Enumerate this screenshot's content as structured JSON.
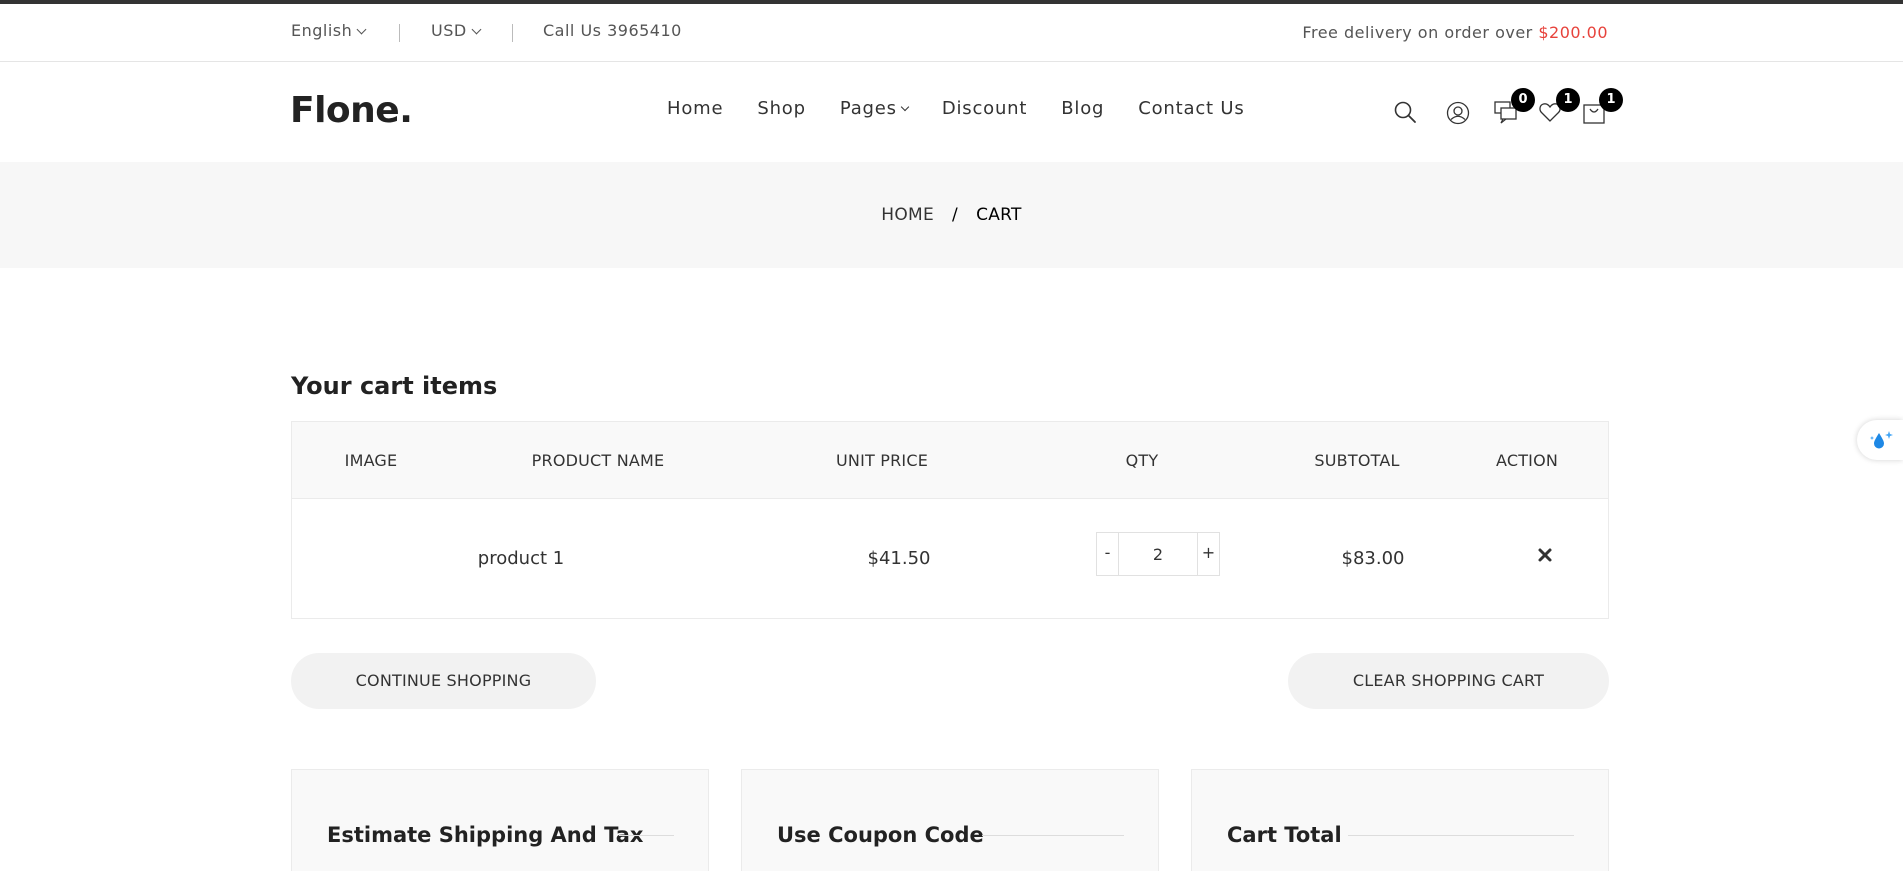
{
  "topbar": {
    "language": "English",
    "currency": "USD",
    "call_us": "Call Us 3965410",
    "free_delivery_text": "Free delivery on order over ",
    "free_delivery_amount": "$200.00",
    "accent_color": "#e7423b"
  },
  "header": {
    "logo": "Flone.",
    "nav": [
      {
        "label": "Home"
      },
      {
        "label": "Shop"
      },
      {
        "label": "Pages"
      },
      {
        "label": "Discount"
      },
      {
        "label": "Blog"
      },
      {
        "label": "Contact Us"
      }
    ],
    "icons": {
      "search": "search-icon",
      "account": "user-icon",
      "compare": "compare-icon",
      "wishlist": "heart-icon",
      "cart": "shopping-bag-icon"
    },
    "badges": {
      "compare_count": "0",
      "wishlist_count": "1",
      "cart_count": "1"
    }
  },
  "breadcrumb": {
    "home": "HOME",
    "separator": "/",
    "current": "CART"
  },
  "cart": {
    "title": "Your cart items",
    "columns": [
      "IMAGE",
      "PRODUCT NAME",
      "UNIT PRICE",
      "QTY",
      "SUBTOTAL",
      "ACTION"
    ],
    "rows": [
      {
        "product_name": "product 1",
        "unit_price": "$41.50",
        "qty": "2",
        "subtotal": "$83.00",
        "action_icon": "close-icon"
      }
    ],
    "qty_dec": "-",
    "qty_inc": "+",
    "continue_label": "CONTINUE SHOPPING",
    "clear_label": "CLEAR SHOPPING CART"
  },
  "panels": {
    "shipping_title": "Estimate Shipping And Tax",
    "coupon_title": "Use Coupon Code",
    "total_title": "Cart Total"
  },
  "side_widget": {
    "icon": "droplet-sparkle-icon"
  }
}
